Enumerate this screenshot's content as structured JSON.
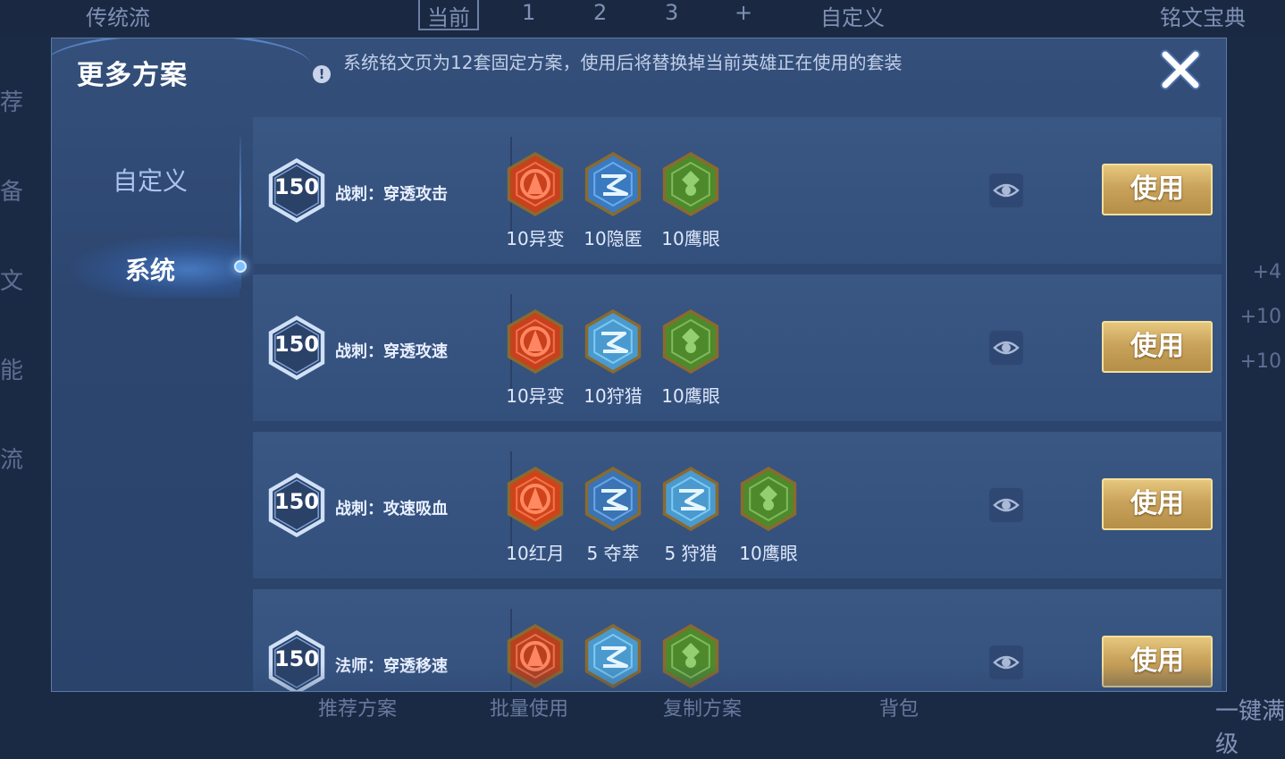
{
  "background": {
    "top_title": "传统流",
    "tabs": [
      "当前",
      "1",
      "2",
      "3",
      "+"
    ],
    "custom_label": "自定义",
    "codex_label": "铭文宝典",
    "side_items": [
      "荐",
      "备",
      "文",
      "能",
      "流"
    ],
    "right_values": [
      "+4",
      "+10",
      "+10"
    ],
    "bottom_items": [
      "推荐方案",
      "批量使用",
      "复制方案",
      "背包",
      "一键满级"
    ]
  },
  "dialog": {
    "title": "更多方案",
    "info_text": "系统铭文页为12套固定方案，使用后将替换掉当前英雄正在使用的套装",
    "close_label": "×"
  },
  "sidebar": {
    "tabs": [
      {
        "label": "自定义",
        "active": false
      },
      {
        "label": "系统",
        "active": true
      }
    ]
  },
  "plans": [
    {
      "level": "150",
      "name": "战刺：穿透攻击",
      "use_label": "使用",
      "runes": [
        {
          "icon": "red-rune-icon",
          "label": "10异变",
          "color": "#c8401c"
        },
        {
          "icon": "blue-rune-icon",
          "label": "10隐匿",
          "color": "#3a7ac0"
        },
        {
          "icon": "green-rune-icon",
          "label": "10鹰眼",
          "color": "#4e8a2c"
        }
      ]
    },
    {
      "level": "150",
      "name": "战刺：穿透攻速",
      "use_label": "使用",
      "runes": [
        {
          "icon": "red-rune-icon",
          "label": "10异变",
          "color": "#c8401c"
        },
        {
          "icon": "blue-rune-icon",
          "label": "10狩猎",
          "color": "#4a9ad0"
        },
        {
          "icon": "green-rune-icon",
          "label": "10鹰眼",
          "color": "#4e8a2c"
        }
      ]
    },
    {
      "level": "150",
      "name": "战刺：攻速吸血",
      "use_label": "使用",
      "runes": [
        {
          "icon": "red-rune-icon",
          "label": "10红月",
          "color": "#d0431a"
        },
        {
          "icon": "blue-rune-icon",
          "label": "5 夺萃",
          "color": "#3b74b4"
        },
        {
          "icon": "blue-rune-icon",
          "label": "5 狩猎",
          "color": "#4a9ad0"
        },
        {
          "icon": "green-rune-icon",
          "label": "10鹰眼",
          "color": "#4e8a2c"
        }
      ]
    },
    {
      "level": "150",
      "name": "法师：穿透移速",
      "use_label": "使用",
      "runes": [
        {
          "icon": "red-rune-icon",
          "label": "",
          "color": "#b8401c"
        },
        {
          "icon": "blue-rune-icon",
          "label": "",
          "color": "#4a9ad0"
        },
        {
          "icon": "green-rune-icon",
          "label": "",
          "color": "#4e8a2c"
        }
      ]
    }
  ]
}
